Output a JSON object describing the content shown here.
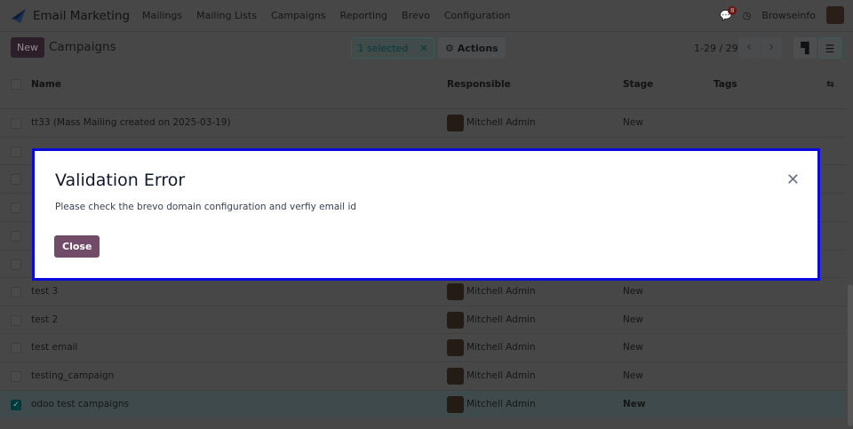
{
  "nav": {
    "app": "Email Marketing",
    "menus": [
      "Mailings",
      "Mailing Lists",
      "Campaigns",
      "Reporting",
      "Brevo",
      "Configuration"
    ],
    "message_count": "8",
    "user": "Browseinfo"
  },
  "control": {
    "new_label": "New",
    "title": "Campaigns",
    "selected": "1 selected",
    "actions": "Actions",
    "pager": "1-29 / 29"
  },
  "table": {
    "headers": {
      "name": "Name",
      "responsible": "Responsible",
      "stage": "Stage",
      "tags": "Tags"
    },
    "rows": [
      {
        "name": "tt33 (Mass Mailing created on 2025-03-19)",
        "responsible": "Mitchell Admin",
        "stage": "New"
      },
      {
        "name": "test 3",
        "responsible": "Mitchell Admin",
        "stage": "New"
      },
      {
        "name": "test 2",
        "responsible": "Mitchell Admin",
        "stage": "New"
      },
      {
        "name": "test email",
        "responsible": "Mitchell Admin",
        "stage": "New"
      },
      {
        "name": "testing_campaign",
        "responsible": "Mitchell Admin",
        "stage": "New"
      },
      {
        "name": "odoo test campaigns",
        "responsible": "Mitchell Admin",
        "stage": "New",
        "selected": true
      }
    ]
  },
  "dialog": {
    "title": "Validation Error",
    "message": "Please check the brevo domain configuration and verfiy email id",
    "close_label": "Close"
  }
}
